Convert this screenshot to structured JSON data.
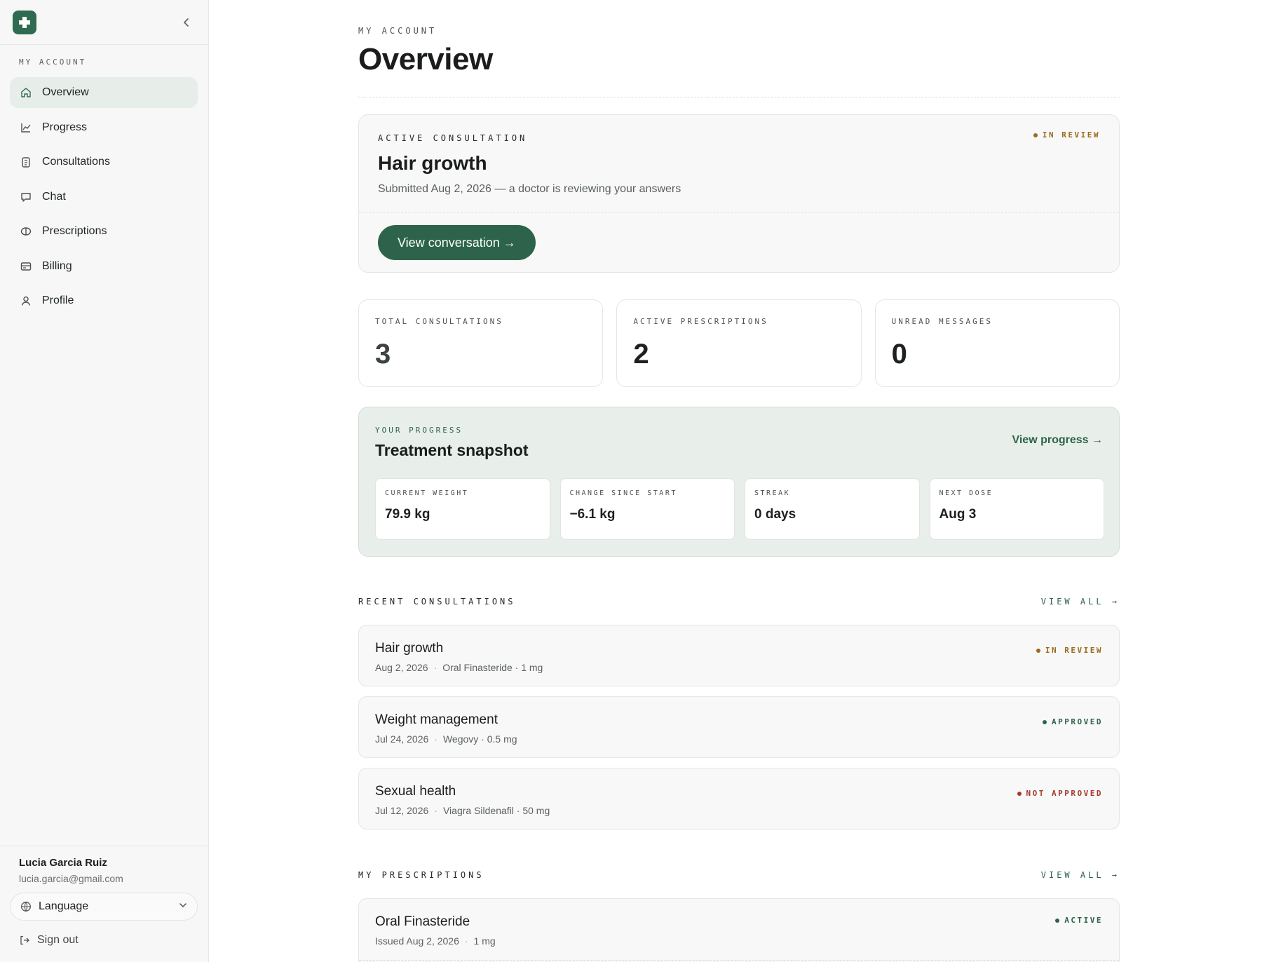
{
  "sidebar": {
    "section_label": "My account",
    "items": [
      {
        "label": "Overview",
        "icon": "home-icon"
      },
      {
        "label": "Progress",
        "icon": "chart-line-icon"
      },
      {
        "label": "Consultations",
        "icon": "clipboard-icon"
      },
      {
        "label": "Chat",
        "icon": "chat-bubble-icon"
      },
      {
        "label": "Prescriptions",
        "icon": "pill-icon"
      },
      {
        "label": "Billing",
        "icon": "billing-card-icon"
      },
      {
        "label": "Profile",
        "icon": "user-icon"
      }
    ],
    "user": {
      "name": "Lucia Garcia Ruiz",
      "email": "lucia.garcia@gmail.com"
    },
    "language_label": "Language",
    "signout_label": "Sign out"
  },
  "page": {
    "eyebrow": "My account",
    "title": "Overview"
  },
  "active_consultation": {
    "eyebrow": "Active consultation",
    "status": "In review",
    "title": "Hair growth",
    "subtitle": "Submitted Aug 2, 2026 — a doctor is reviewing your answers",
    "button_label": "View conversation →"
  },
  "stats": [
    {
      "label": "Total consultations",
      "value": "3"
    },
    {
      "label": "Active prescriptions",
      "value": "2"
    },
    {
      "label": "Unread messages",
      "value": "0"
    }
  ],
  "progress": {
    "eyebrow": "Your progress",
    "title": "Treatment snapshot",
    "link_label": "View progress →",
    "items": [
      {
        "label": "Current weight",
        "value": "79.9 kg"
      },
      {
        "label": "Change since start",
        "value": "−6.1 kg"
      },
      {
        "label": "Streak",
        "value": "0 days"
      },
      {
        "label": "Next dose",
        "value": "Aug 3"
      }
    ]
  },
  "recent_consultations": {
    "heading": "Recent consultations",
    "view_all": "View all →",
    "items": [
      {
        "title": "Hair growth",
        "date": "Aug 2, 2026",
        "detail": "Oral Finasteride · 1 mg",
        "status": "In review"
      },
      {
        "title": "Weight management",
        "date": "Jul 24, 2026",
        "detail": "Wegovy · 0.5 mg",
        "status": "Approved"
      },
      {
        "title": "Sexual health",
        "date": "Jul 12, 2026",
        "detail": "Viagra Sildenafil · 50 mg",
        "status": "Not approved"
      }
    ]
  },
  "prescriptions": {
    "heading": "My prescriptions",
    "view_all": "View all →",
    "items": [
      {
        "title": "Oral Finasteride",
        "issued": "Issued Aug 2, 2026",
        "dose": "1 mg",
        "status": "Active"
      }
    ]
  },
  "colors": {
    "brand": "#2f6b50",
    "in_review": "#9a6a1d",
    "approved": "#2d634a",
    "not_approved": "#a33a2c"
  }
}
